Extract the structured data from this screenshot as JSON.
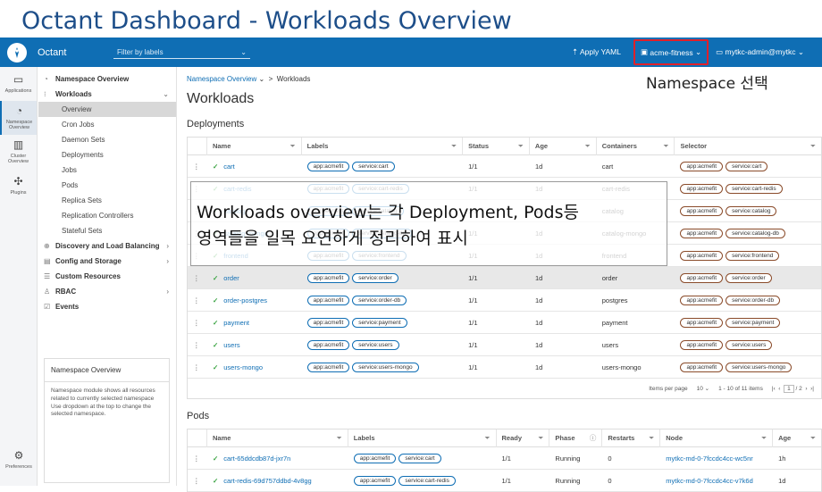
{
  "slide_title": "Octant Dashboard - Workloads Overview",
  "topbar": {
    "app_name": "Octant",
    "filter_placeholder": "Filter by labels",
    "apply_yaml": "Apply YAML",
    "namespace": "acme-fitness",
    "context": "mytkc-admin@mytkc"
  },
  "rail": {
    "applications": "Applications",
    "namespace_overview": "Namespace Overview",
    "cluster_overview": "Cluster Overview",
    "plugins": "Plugins",
    "preferences": "Preferences"
  },
  "nav": {
    "namespace_overview": "Namespace Overview",
    "workloads": "Workloads",
    "items": [
      "Overview",
      "Cron Jobs",
      "Daemon Sets",
      "Deployments",
      "Jobs",
      "Pods",
      "Replica Sets",
      "Replication Controllers",
      "Stateful Sets"
    ],
    "discovery": "Discovery and Load Balancing",
    "config": "Config and Storage",
    "custom": "Custom Resources",
    "rbac": "RBAC",
    "events": "Events"
  },
  "help": {
    "title": "Namespace Overview",
    "body": "Namespace module shows all resources related to currently selected namespace Use dropdown at the top to change the selected namespace."
  },
  "main": {
    "breadcrumb_link": "Namespace Overview",
    "breadcrumb_current": "Workloads",
    "title": "Workloads",
    "deployments_heading": "Deployments",
    "pods_heading": "Pods"
  },
  "annotation_namespace": "Namespace 선택",
  "overlay": {
    "line1": "Workloads overview는 각 Deployment, Pods등",
    "line2": "영역들을 일목 요연하게 정리하여 표시"
  },
  "deployments": {
    "columns": [
      "Name",
      "Labels",
      "Status",
      "Age",
      "Containers",
      "Selector"
    ],
    "rows": [
      {
        "name": "cart",
        "l1": "app:acmefit",
        "l2": "service:cart",
        "status": "1/1",
        "age": "1d",
        "containers": "cart",
        "s1": "app:acmefit",
        "s2": "service:cart"
      },
      {
        "name": "cart-redis",
        "l1": "app:acmefit",
        "l2": "service:cart-redis",
        "status": "1/1",
        "age": "1d",
        "containers": "cart-redis",
        "s1": "app:acmefit",
        "s2": "service:cart-redis"
      },
      {
        "name": "catalog",
        "l1": "app:acmefit",
        "l2": "service:catalog",
        "status": "1/1",
        "age": "1d",
        "containers": "catalog",
        "s1": "app:acmefit",
        "s2": "service:catalog"
      },
      {
        "name": "catalog-mongo",
        "l1": "app:acmefit",
        "l2": "service:catalog-db",
        "status": "1/1",
        "age": "1d",
        "containers": "catalog-mongo",
        "s1": "app:acmefit",
        "s2": "service:catalog-db"
      },
      {
        "name": "frontend",
        "l1": "app:acmefit",
        "l2": "service:frontend",
        "status": "1/1",
        "age": "1d",
        "containers": "frontend",
        "s1": "app:acmefit",
        "s2": "service:frontend"
      },
      {
        "name": "order",
        "l1": "app:acmefit",
        "l2": "service:order",
        "status": "1/1",
        "age": "1d",
        "containers": "order",
        "s1": "app:acmefit",
        "s2": "service:order"
      },
      {
        "name": "order-postgres",
        "l1": "app:acmefit",
        "l2": "service:order-db",
        "status": "1/1",
        "age": "1d",
        "containers": "postgres",
        "s1": "app:acmefit",
        "s2": "service:order-db"
      },
      {
        "name": "payment",
        "l1": "app:acmefit",
        "l2": "service:payment",
        "status": "1/1",
        "age": "1d",
        "containers": "payment",
        "s1": "app:acmefit",
        "s2": "service:payment"
      },
      {
        "name": "users",
        "l1": "app:acmefit",
        "l2": "service:users",
        "status": "1/1",
        "age": "1d",
        "containers": "users",
        "s1": "app:acmefit",
        "s2": "service:users"
      },
      {
        "name": "users-mongo",
        "l1": "app:acmefit",
        "l2": "service:users-mongo",
        "status": "1/1",
        "age": "1d",
        "containers": "users-mongo",
        "s1": "app:acmefit",
        "s2": "service:users-mongo"
      }
    ],
    "pager": {
      "items_per_page": "Items per page",
      "page_size": "10",
      "range": "1 - 10 of 11 items",
      "page": "1",
      "total": "/ 2"
    }
  },
  "pods": {
    "columns": [
      "Name",
      "Labels",
      "Ready",
      "Phase",
      "Restarts",
      "Node",
      "Age"
    ],
    "rows": [
      {
        "name": "cart-65ddcdb87d-jxr7n",
        "l1": "app:acmefit",
        "l2": "service:cart",
        "ready": "1/1",
        "phase": "Running",
        "restarts": "0",
        "node": "mytkc-md-0-7fccdc4cc-wc5nr",
        "age": "1h"
      },
      {
        "name": "cart-redis-69d757ddbd-4v8gg",
        "l1": "app:acmefit",
        "l2": "service:cart-redis",
        "ready": "1/1",
        "phase": "Running",
        "restarts": "0",
        "node": "mytkc-md-0-7fccdc4cc-v7k6d",
        "age": "1d"
      }
    ]
  }
}
